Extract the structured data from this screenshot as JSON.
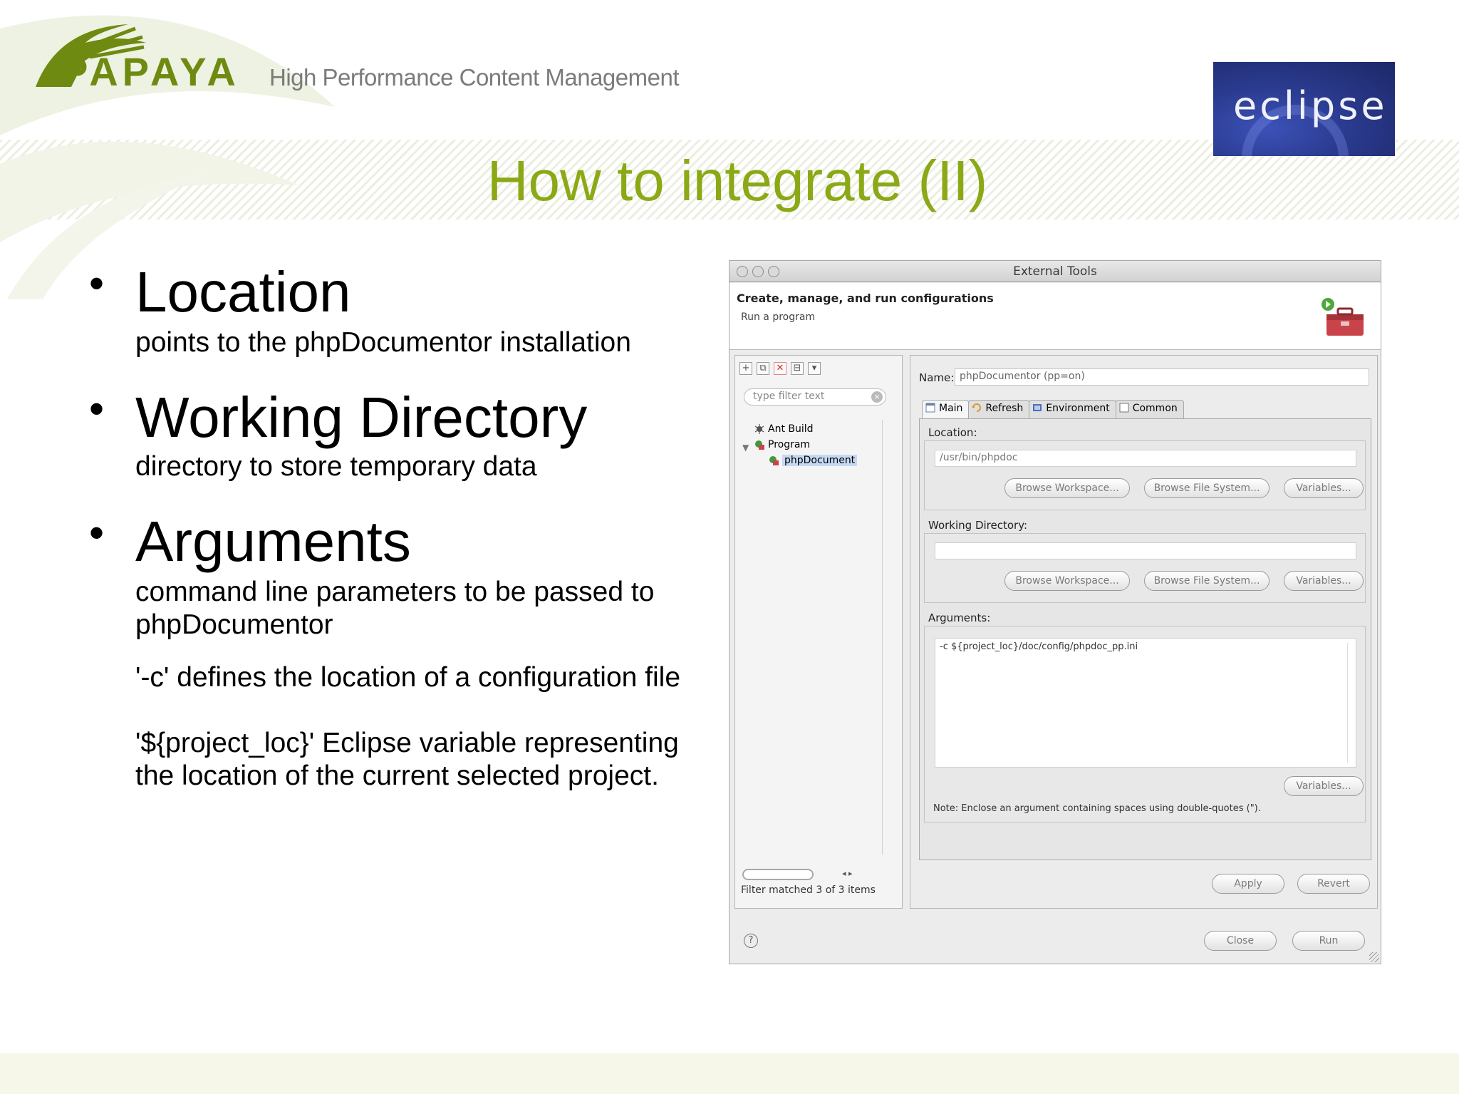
{
  "slide": {
    "logo_text": "PAPAYA",
    "tagline": "High Performance Content Management",
    "eclipse_logo_text": "eclipse",
    "title": "How to integrate (II)",
    "bullets": [
      {
        "heading": "Location",
        "lines": [
          "points to the phpDocumentor installation"
        ]
      },
      {
        "heading": "Working Directory",
        "lines": [
          "directory to store temporary data"
        ]
      },
      {
        "heading": "Arguments",
        "lines": [
          "command line parameters to be passed to",
          "phpDocumentor",
          "'-c' defines the location of a configuration file",
          "'${project_loc}' Eclipse variable representing",
          "the location of the current selected project."
        ]
      }
    ],
    "colors": {
      "title_green": "#8ba916",
      "logo_green": "#6e8a10",
      "eclipse_blue": "#2a3a8e"
    }
  },
  "dialog": {
    "window_title": "External Tools",
    "header_title": "Create, manage, and run configurations",
    "header_subtitle": "Run a program",
    "filter_placeholder": "type filter text",
    "tree": [
      {
        "label": "Ant Build",
        "icon": "ant-build-icon"
      },
      {
        "label": "Program",
        "icon": "program-icon",
        "expanded": true
      },
      {
        "label": "phpDocument",
        "icon": "program-config-icon",
        "selected": true
      }
    ],
    "filter_status": "Filter matched 3 of 3 items",
    "name_label": "Name:",
    "name_value": "phpDocumentor (pp=on)",
    "tabs": [
      {
        "label": "Main",
        "icon": "main-tab-icon",
        "active": true
      },
      {
        "label": "Refresh",
        "icon": "refresh-icon"
      },
      {
        "label": "Environment",
        "icon": "environment-icon"
      },
      {
        "label": "Common",
        "icon": "common-icon"
      }
    ],
    "location": {
      "label": "Location:",
      "value": "/usr/bin/phpdoc",
      "browse_workspace": "Browse Workspace...",
      "browse_file_system": "Browse File System...",
      "variables": "Variables..."
    },
    "working_directory": {
      "label": "Working Directory:",
      "value": "",
      "browse_workspace": "Browse Workspace...",
      "browse_file_system": "Browse File System...",
      "variables": "Variables..."
    },
    "arguments": {
      "label": "Arguments:",
      "value": "-c ${project_loc}/doc/config/phpdoc_pp.ini",
      "variables": "Variables...",
      "note": "Note: Enclose an argument containing spaces using double-quotes (\")."
    },
    "apply": "Apply",
    "revert": "Revert",
    "close": "Close",
    "run": "Run"
  }
}
